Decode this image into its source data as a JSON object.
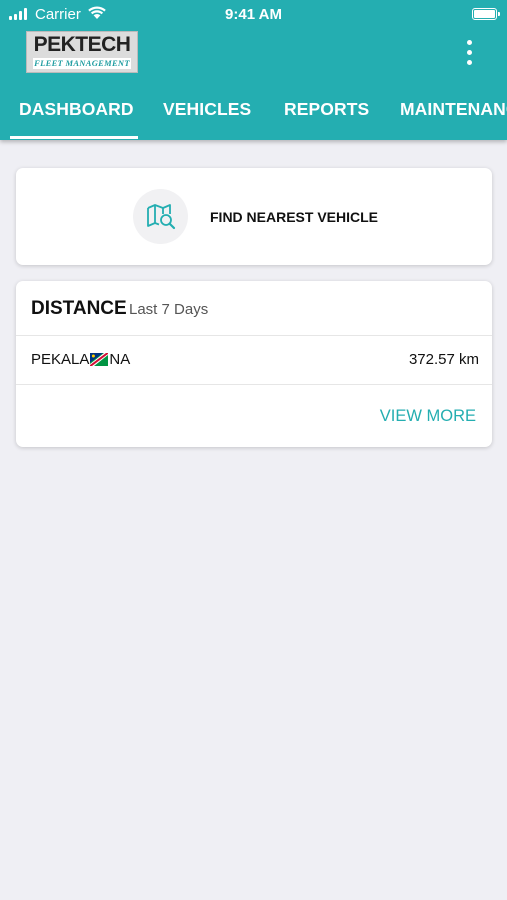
{
  "status_bar": {
    "carrier": "Carrier",
    "time": "9:41 AM"
  },
  "app_bar": {
    "logo_title": "PEKTECH",
    "logo_subtitle": "FLEET MANAGEMENT",
    "menu_icon": "more-vertical-icon"
  },
  "tabs": [
    {
      "label": "DASHBOARD",
      "active": true
    },
    {
      "label": "VEHICLES",
      "active": false
    },
    {
      "label": "REPORTS",
      "active": false
    },
    {
      "label": "MAINTENANCE",
      "active": false
    }
  ],
  "find_card": {
    "icon": "map-search-icon",
    "label": "FIND NEAREST VEHICLE"
  },
  "distance_card": {
    "title": "DISTANCE",
    "period": "Last 7 Days",
    "rows": [
      {
        "name_prefix": "PEKALA",
        "flag": "namibia-flag-icon",
        "name_suffix": "NA",
        "value": "372.57 km"
      }
    ],
    "view_more_label": "VIEW MORE"
  },
  "colors": {
    "primary": "#24aeb1",
    "background": "#efeff4",
    "card": "#ffffff"
  }
}
